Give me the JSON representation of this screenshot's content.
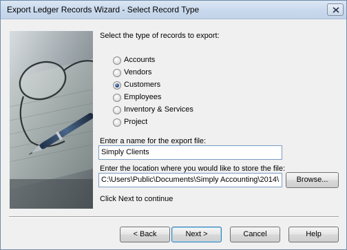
{
  "window": {
    "title": "Export Ledger Records Wizard - Select Record Type"
  },
  "prompt": "Select the type of records to export:",
  "record_types": [
    {
      "label": "Accounts",
      "checked": false
    },
    {
      "label": "Vendors",
      "checked": false
    },
    {
      "label": "Customers",
      "checked": true
    },
    {
      "label": "Employees",
      "checked": false
    },
    {
      "label": "Inventory & Services",
      "checked": false
    },
    {
      "label": "Project",
      "checked": false
    }
  ],
  "file_name": {
    "label": "Enter a name for the export file:",
    "value": "Simply Clients"
  },
  "location": {
    "label": "Enter the location where you would like to store the file:",
    "value": "C:\\Users\\Public\\Documents\\Simply Accounting\\2014\\",
    "browse_label": "Browse..."
  },
  "hint": "Click Next to continue",
  "buttons": {
    "back": "< Back",
    "next": "Next >",
    "cancel": "Cancel",
    "help": "Help"
  },
  "icons": {
    "close": "close-icon",
    "picture": "glasses-pen-cheque-image"
  }
}
